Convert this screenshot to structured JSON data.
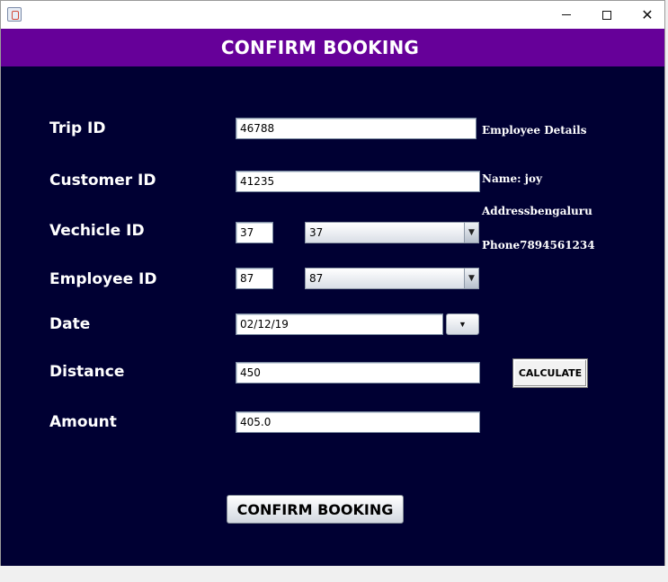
{
  "window": {
    "icon": "java-icon",
    "controls": {
      "minimize": "minimize-icon",
      "maximize": "maximize-icon",
      "close": "close-icon"
    }
  },
  "header": {
    "title": "CONFIRM BOOKING",
    "background": "#660099"
  },
  "panel": {
    "background": "#000033"
  },
  "form": {
    "trip_id": {
      "label": "Trip ID",
      "value": "46788"
    },
    "customer_id": {
      "label": "Customer ID",
      "value": "41235"
    },
    "vehicle_id": {
      "label": "Vechicle ID",
      "value": "37",
      "selected": "37"
    },
    "employee_id": {
      "label": "Employee ID",
      "value": "87",
      "selected": "87"
    },
    "date": {
      "label": "Date",
      "value": "02/12/19"
    },
    "distance": {
      "label": "Distance",
      "value": "450"
    },
    "amount": {
      "label": "Amount",
      "value": "405.0"
    }
  },
  "employee_details": {
    "heading": "Employee Details",
    "name": "Name: joy",
    "address": "Addressbengaluru",
    "phone": "Phone7894561234"
  },
  "buttons": {
    "calculate": "CALCULATE",
    "confirm": "CONFIRM BOOKING"
  }
}
